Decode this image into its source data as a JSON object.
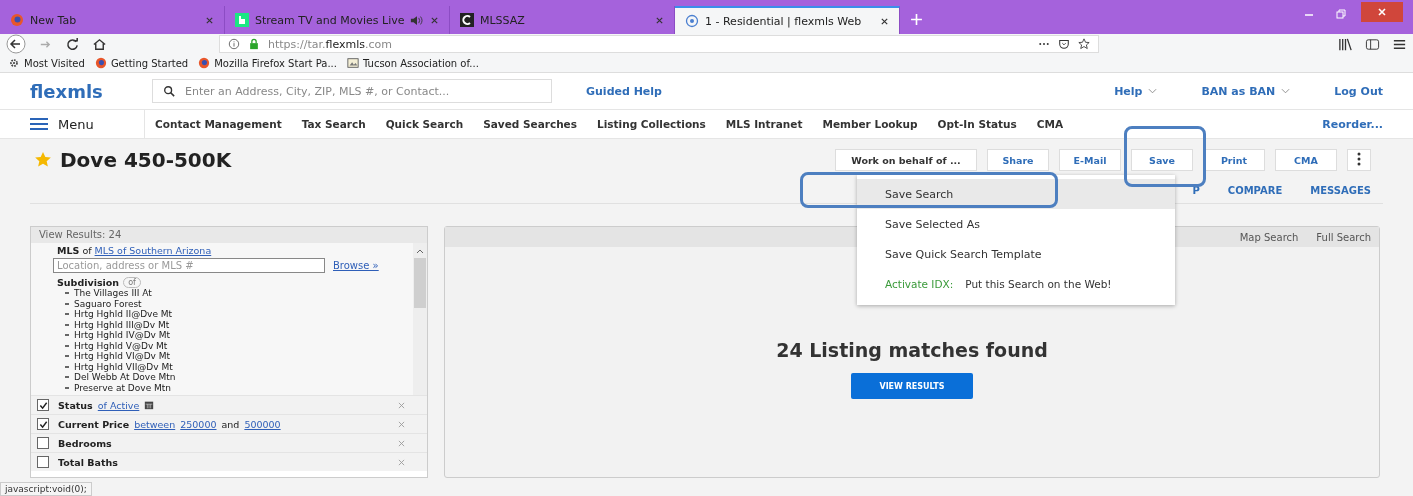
{
  "browser_tabs": [
    {
      "title": "New Tab",
      "kind": "firefox",
      "selected": false
    },
    {
      "title": "Stream TV and Movies Live",
      "kind": "hulu",
      "audio": true,
      "selected": false
    },
    {
      "title": "MLSSAZ",
      "kind": "mlssaz",
      "selected": false
    },
    {
      "title": "1 - Residential | flexmls Web",
      "kind": "globe",
      "selected": true
    }
  ],
  "address_bar": {
    "url": "https://tar.**flexmls**.com"
  },
  "bookmarks": [
    {
      "label": "Most Visited",
      "kind": "gear"
    },
    {
      "label": "Getting Started",
      "kind": "firefox"
    },
    {
      "label": "Mozilla Firefox Start Pa...",
      "kind": "firefox"
    },
    {
      "label": "Tucson Association of...",
      "kind": "image"
    }
  ],
  "header": {
    "logo": "flexmls",
    "search_placeholder": "Enter an Address, City, ZIP, MLS #, or Contact...",
    "guided_help": "Guided Help",
    "help": "Help",
    "user": "BAN as BAN",
    "logout": "Log Out"
  },
  "menu": {
    "label": "Menu",
    "items": [
      "Contact Management",
      "Tax Search",
      "Quick Search",
      "Saved Searches",
      "Listing Collections",
      "MLS Intranet",
      "Member Lookup",
      "Opt-In Status",
      "CMA"
    ],
    "reorder": "Reorder..."
  },
  "search": {
    "title": "Dove 450-500K",
    "starred": true,
    "actions": [
      "Work on behalf of ...",
      "Share",
      "E-Mail",
      "Save",
      "Print",
      "CMA"
    ],
    "view_tabs": [
      "P",
      "COMPARE",
      "MESSAGES"
    ]
  },
  "save_menu": {
    "items": [
      {
        "label": "Save Search",
        "selected": true
      },
      {
        "label": "Save Selected As",
        "selected": false
      },
      {
        "label": "Save Quick Search Template",
        "selected": false
      }
    ],
    "idx_label": "Activate IDX:",
    "idx_text": "Put this Search on the Web!"
  },
  "criteria_panel": {
    "header": "View Results: 24",
    "mls_label": "MLS",
    "mls_of": "of",
    "mls_value": "MLS of Southern Arizona",
    "location_placeholder": "Location, address or MLS #",
    "browse": "Browse »",
    "subdivision_label": "Subdivision",
    "subdivision_badge": "of",
    "subdivisions": [
      "The Villages III At",
      "Saguaro Forest",
      "Hrtg Hghld II@Dve Mt",
      "Hrtg Hghld III@Dv Mt",
      "Hrtg Hghld IV@Dv Mt",
      "Hrtg Hghld V@Dv Mt",
      "Hrtg Hghld VI@Dv Mt",
      "Hrtg Hghld VII@Dv Mt",
      "Del Webb At Dove Mtn",
      "Preserve at Dove Mtn"
    ],
    "filters": [
      {
        "label": "Status",
        "checked": true,
        "calendar": true,
        "parts": [
          {
            "text": "of Active",
            "kind": "link"
          }
        ]
      },
      {
        "label": "Current Price",
        "checked": true,
        "parts": [
          {
            "text": "between",
            "kind": "link"
          },
          {
            "text": "250000",
            "kind": "link"
          },
          {
            "text": "and",
            "kind": "text"
          },
          {
            "text": "500000",
            "kind": "link"
          }
        ]
      },
      {
        "label": "Bedrooms",
        "checked": false
      },
      {
        "label": "Total Baths",
        "checked": false
      }
    ]
  },
  "results_panel": {
    "links": [
      "Map Search",
      "Full Search"
    ],
    "message": "24 Listing matches found",
    "button": "VIEW RESULTS"
  },
  "status_bar": "javascript:void(0);"
}
